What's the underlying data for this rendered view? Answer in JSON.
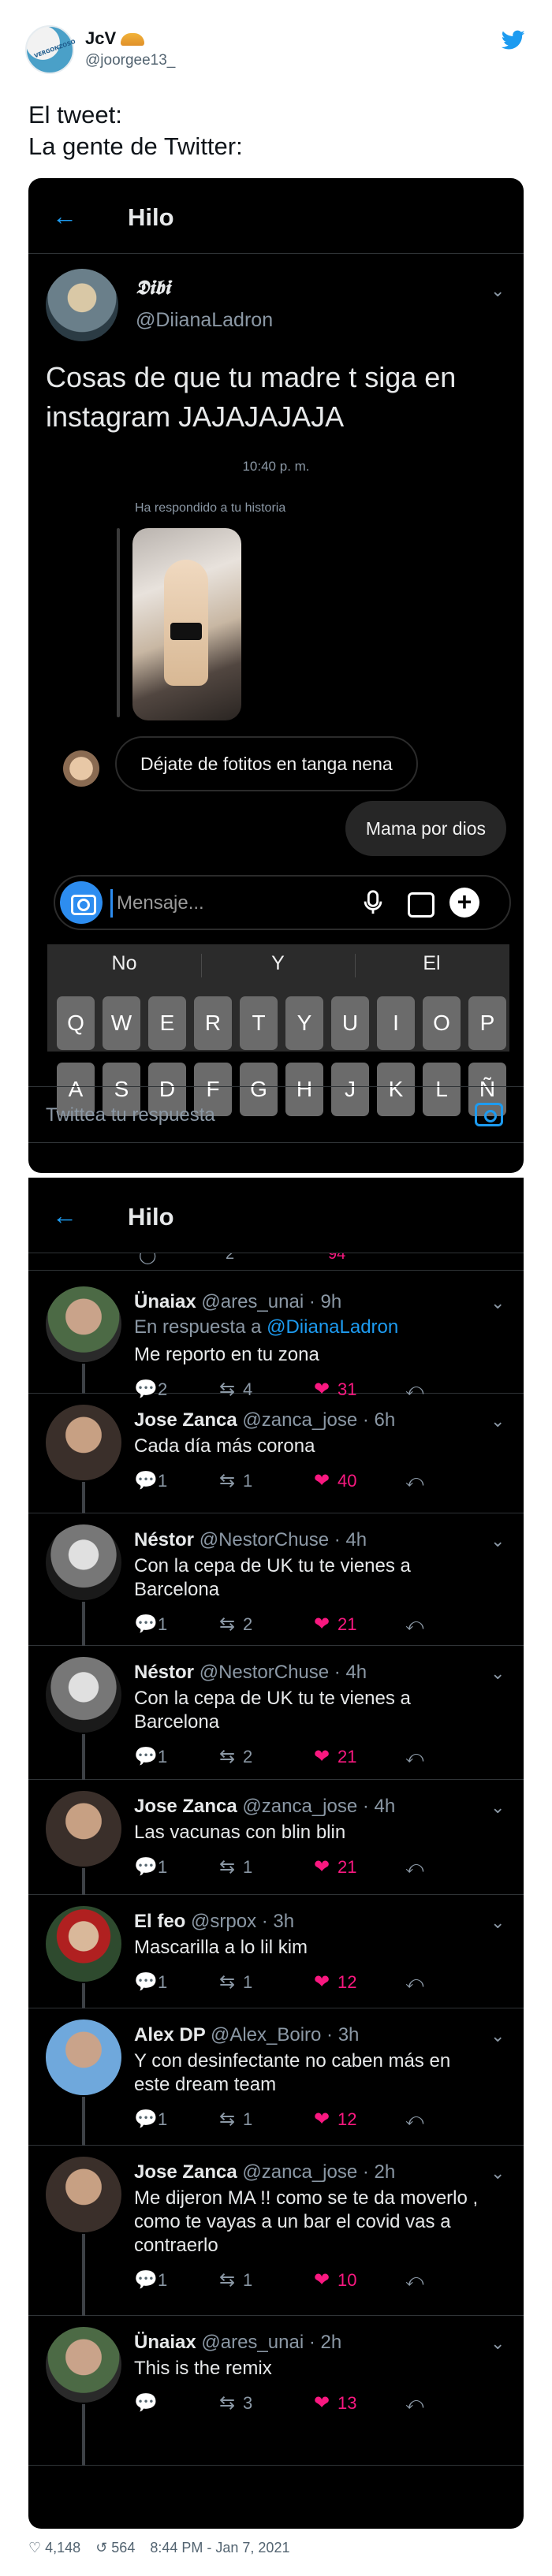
{
  "outer": {
    "avatar_text": "VERGONZOSO",
    "name": "JcV",
    "handle": "@joorgee13_",
    "text_line1": "El tweet:",
    "text_line2": "La gente de Twitter:",
    "stats": {
      "likes": "4,148",
      "retweets": "564",
      "time": "8:44 PM - Jan 7, 2021"
    }
  },
  "panel1": {
    "back_icon": "arrow-left",
    "title": "Hilo",
    "author_name": "𝕯𝖎𝖇𝖎",
    "author_handle": "@DiianaLadron",
    "text": "Cosas de que tu madre t siga en instagram JAJAJAJAJA",
    "chat": {
      "time": "10:40 p. m.",
      "reply_label": "Ha respondido a tu historia",
      "message_in": "Déjate de fotitos en tanga nena",
      "message_out": "Mama por dios",
      "composer_placeholder": "Mensaje...",
      "suggestions": [
        "No",
        "Y",
        "El"
      ],
      "row1": [
        "Q",
        "W",
        "E",
        "R",
        "T",
        "Y",
        "U",
        "I",
        "O",
        "P"
      ],
      "row2": [
        "A",
        "S",
        "D",
        "F",
        "G",
        "H",
        "J",
        "K",
        "L",
        "Ñ"
      ]
    },
    "reply_placeholder": "Twittea tu respuesta"
  },
  "panel2": {
    "title": "Hilo",
    "partial_stats": {
      "retweets": "2",
      "likes": "94"
    },
    "replies": [
      {
        "name": "Ünaiax",
        "handle": "@ares_unai · 9h",
        "in_reply_prefix": "En respuesta a ",
        "in_reply_to": "@DiianaLadron",
        "text": "Me reporto en tu zona",
        "replies": "2",
        "retweets": "4",
        "likes": "31"
      },
      {
        "name": "Jose Zanca",
        "handle": "@zanca_jose · 6h",
        "text": "Cada día más corona",
        "replies": "1",
        "retweets": "1",
        "likes": "40"
      },
      {
        "name": "Néstor",
        "handle": "@NestorChuse · 4h",
        "text": "Con la cepa de UK tu te vienes a Barcelona",
        "replies": "1",
        "retweets": "2",
        "likes": "21"
      },
      {
        "name": "Néstor",
        "handle": "@NestorChuse · 4h",
        "text": "Con la cepa de UK tu te vienes a Barcelona",
        "replies": "1",
        "retweets": "2",
        "likes": "21"
      },
      {
        "name": "Jose Zanca",
        "handle": "@zanca_jose · 4h",
        "text": "Las vacunas con blin blin",
        "replies": "1",
        "retweets": "1",
        "likes": "21"
      },
      {
        "name": "El feo",
        "handle": "@srpox · 3h",
        "text": "Mascarilla a lo lil kim",
        "replies": "1",
        "retweets": "1",
        "likes": "12"
      },
      {
        "name": "Alex DP",
        "handle": "@Alex_Boiro · 3h",
        "text": "Y con desinfectante no caben más en este dream team",
        "replies": "1",
        "retweets": "1",
        "likes": "12"
      },
      {
        "name": "Jose Zanca",
        "handle": "@zanca_jose · 2h",
        "text": "Me dijeron  MA !! como se te da moverlo , como te vayas a un bar el covid vas a contraerlo",
        "replies": "1",
        "retweets": "1",
        "likes": "10"
      },
      {
        "name": "Ünaiax",
        "handle": "@ares_unai · 2h",
        "text": "This is the remix",
        "replies": "",
        "retweets": "3",
        "likes": "13"
      }
    ]
  },
  "colors": {
    "twitter_blue": "#1d9bf0",
    "like_pink": "#f91880",
    "dark_bg": "#000000"
  }
}
